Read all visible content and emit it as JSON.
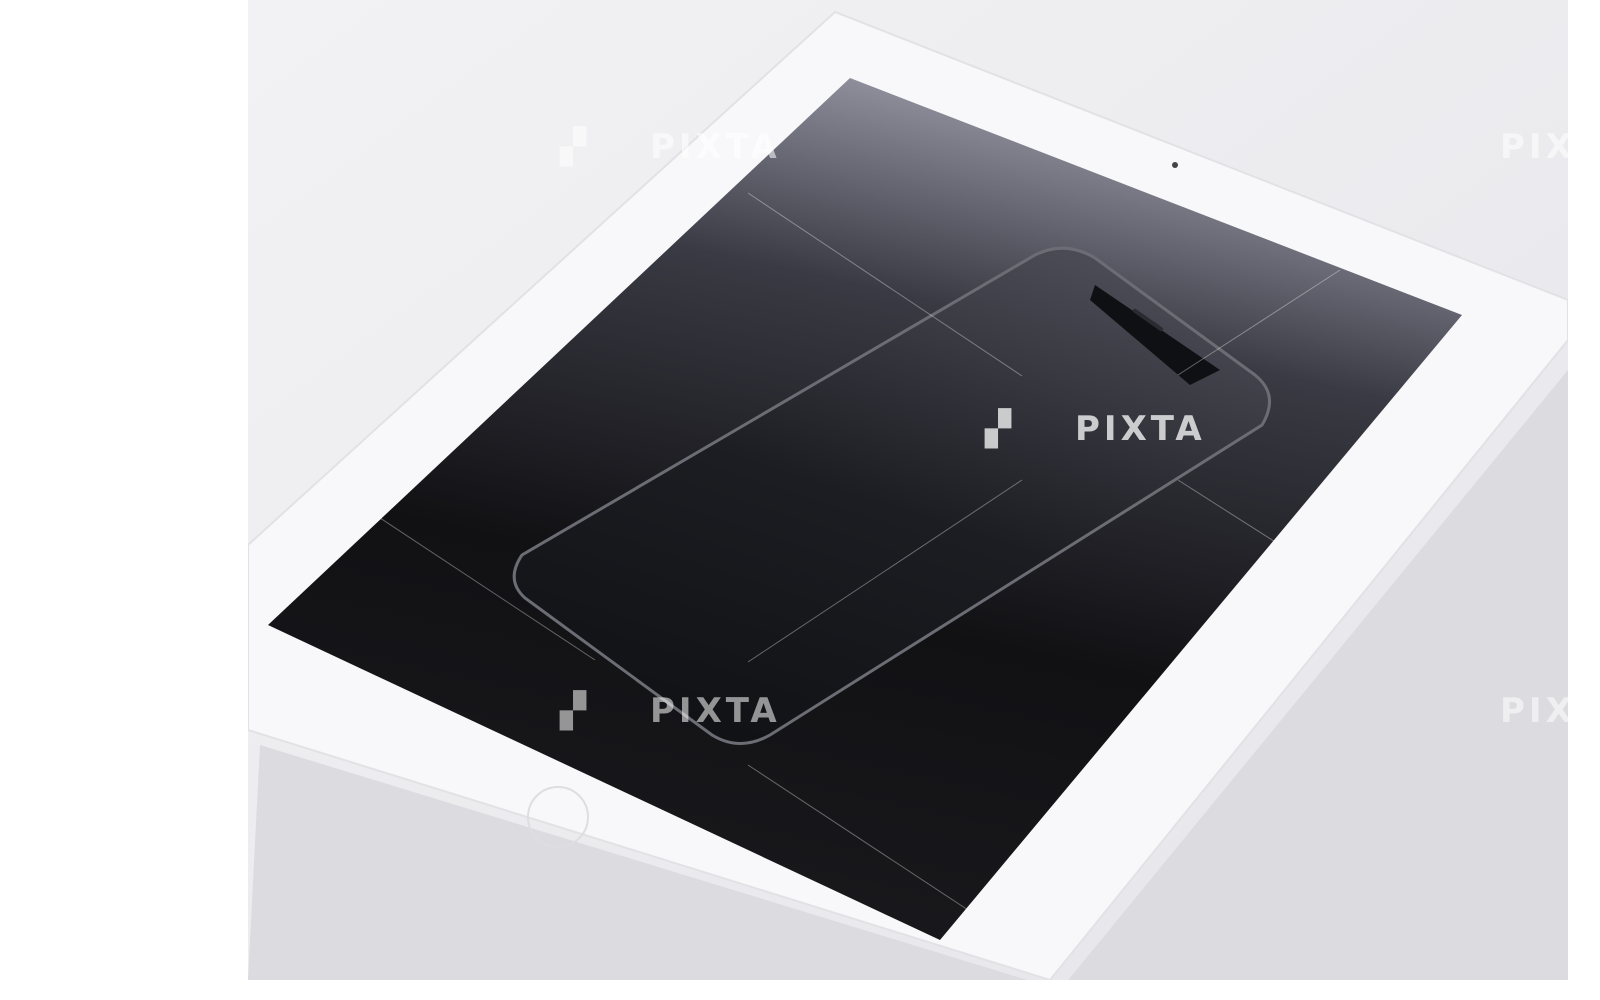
{
  "image": {
    "subject": "smartphone lying on tablet screen",
    "colors": {
      "background": "#ecebef",
      "tablet": "#f7f7f9",
      "screen": "#141416",
      "phone": "#1c1d21"
    }
  },
  "watermark": {
    "text": "PIXTA"
  }
}
